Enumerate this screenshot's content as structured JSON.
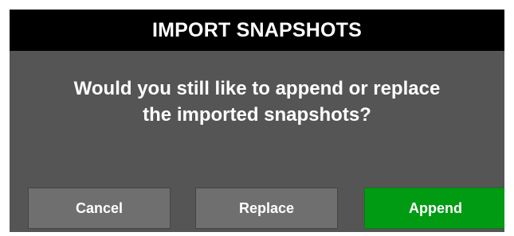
{
  "dialog": {
    "title": "IMPORT SNAPSHOTS",
    "message_line1": "Would you still like to append or replace",
    "message_line2": "the imported snapshots?",
    "buttons": {
      "cancel": "Cancel",
      "replace": "Replace",
      "append": "Append"
    }
  },
  "colors": {
    "title_bar": "#000000",
    "dialog_background": "#555555",
    "button_default": "#6f6f6f",
    "button_primary": "#009b13",
    "text": "#ffffff"
  }
}
